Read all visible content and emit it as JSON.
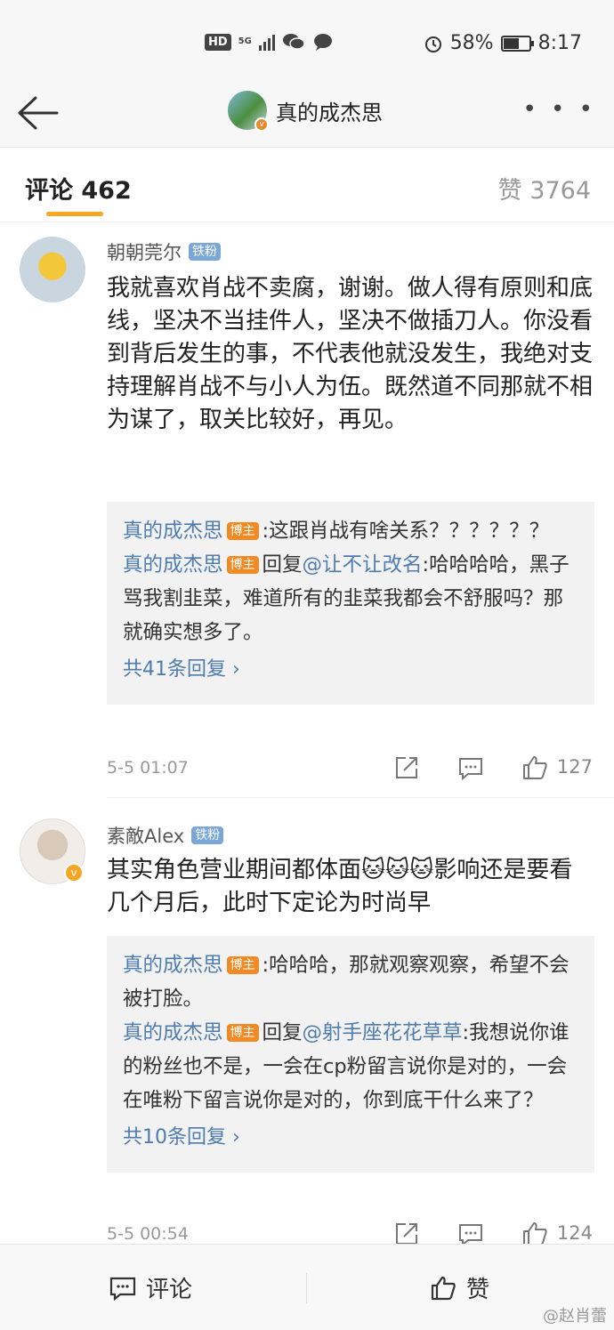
{
  "status_bar": {
    "hd": "HD",
    "network": "5G",
    "battery_percent": "58%",
    "battery_level": 0.58,
    "time": "8:17"
  },
  "nav": {
    "title": "真的成杰思",
    "more_label": "• • •"
  },
  "tabs": {
    "comments": "评论 462",
    "likes": "赞 3764"
  },
  "comments": [
    {
      "user": "朝朝莞尔",
      "fan_badge": "铁粉",
      "text": "我就喜欢肖战不卖腐，谢谢。做人得有原则和底线，坚决不当挂件人，坚决不做插刀人。你没看到背后发生的事，不代表他就没发生，我绝对支持理解肖战不与小人为伍。既然道不同那就不相为谋了，取关比较好，再见。",
      "replies": [
        {
          "name": "真的成杰思",
          "badge": "博主",
          "text": ":这跟肖战有啥关系？？？？？？"
        },
        {
          "name": "真的成杰思",
          "badge": "博主",
          "reply_prefix": "回复",
          "mention": "@让不让改名",
          "text": ":哈哈哈哈，黑子骂我割韭菜，难道所有的韭菜我都会不舒服吗？那就确实想多了。"
        }
      ],
      "more_replies": "共41条回复 ›",
      "date": "5-5 01:07",
      "likes": "127"
    },
    {
      "user": "素敵Alex",
      "fan_badge": "铁粉",
      "text": "其实角色营业期间都体面🐱🐱🐱影响还是要看几个月后，此时下定论为时尚早",
      "replies": [
        {
          "name": "真的成杰思",
          "badge": "博主",
          "text": ":哈哈哈，那就观察观察，希望不会被打脸。"
        },
        {
          "name": "真的成杰思",
          "badge": "博主",
          "reply_prefix": "回复",
          "mention": "@射手座花花草草",
          "text": ":我想说你谁的粉丝也不是，一会在cp粉留言说你是对的，一会在唯粉下留言说你是对的，你到底干什么来了？"
        }
      ],
      "more_replies": "共10条回复 ›",
      "date": "5-5 00:54",
      "likes": "124"
    }
  ],
  "bottom_bar": {
    "comment_label": "评论",
    "like_label": "赞",
    "watermark": "@赵肖蕾"
  },
  "colors": {
    "link_blue": "#4f7cae",
    "accent_orange": "#f5a623",
    "blogger_badge": "#f08a24",
    "fan_badge": "#7aa7d8"
  }
}
